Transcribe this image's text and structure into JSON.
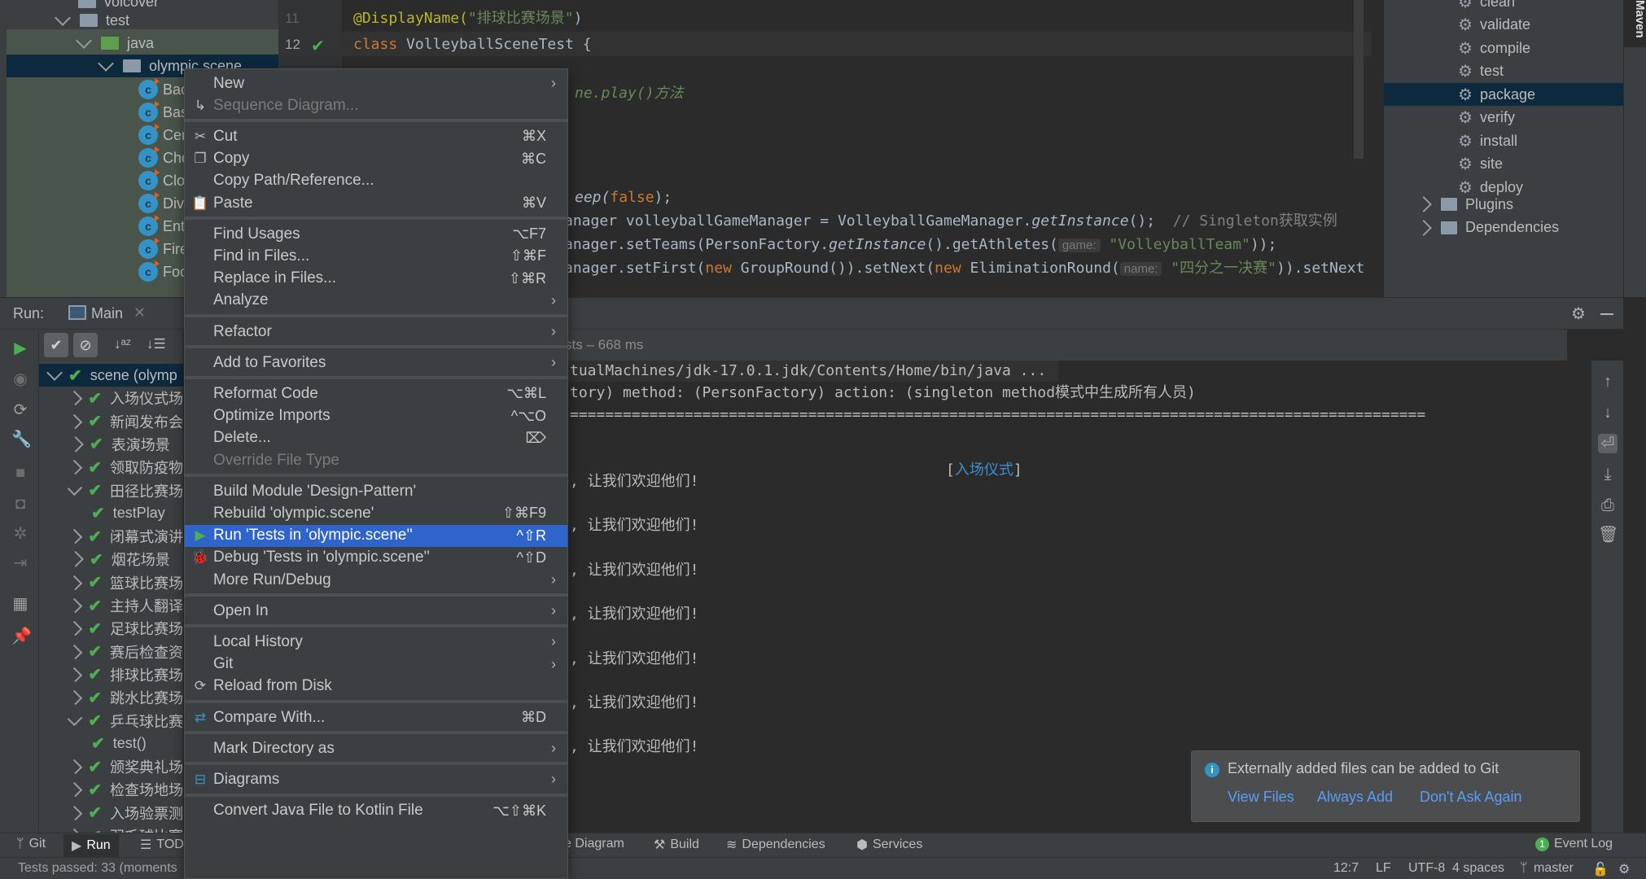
{
  "project_tree": {
    "rows": [
      {
        "label": "volcover",
        "type": "folder-partial"
      },
      {
        "label": "test",
        "type": "folder"
      },
      {
        "label": "java",
        "type": "test-folder"
      },
      {
        "label": "olympic.scene",
        "type": "package",
        "selected": true
      }
    ],
    "classes": [
      "Bac",
      "Bas",
      "Cer",
      "Cho",
      "Clo",
      "Div",
      "Ent",
      "Fire",
      "Foo"
    ]
  },
  "editor": {
    "lines": [
      {
        "num": "11",
        "segments": [
          {
            "t": "@DisplayName(",
            "c": "ann"
          },
          {
            "t": "\"排球比赛场景\"",
            "c": "str"
          },
          {
            "t": ")",
            "c": ""
          }
        ]
      },
      {
        "num": "12",
        "segments": [
          {
            "t": "class ",
            "c": "kw"
          },
          {
            "t": "VolleyballSceneTest {",
            "c": ""
          }
        ]
      },
      {
        "num": "",
        "segments": [
          {
            "t": "ne.play()方法",
            "c": "str it"
          }
        ]
      },
      {
        "num": "",
        "segments": [
          {
            "t": "eep(",
            "c": "it"
          },
          {
            "t": "false",
            "c": "kw"
          },
          {
            "t": ");",
            "c": ""
          }
        ]
      },
      {
        "num": "",
        "segments": [
          {
            "t": "anager volleyballGameManager = VolleyballGameManager.",
            "c": ""
          },
          {
            "t": "getInstance",
            "c": "it"
          },
          {
            "t": "();",
            "c": ""
          },
          {
            "t": "  // Singleton获取实例",
            "c": "cmt"
          }
        ]
      },
      {
        "num": "",
        "segments": [
          {
            "t": "anager.setTeams(PersonFactory.",
            "c": ""
          },
          {
            "t": "getInstance",
            "c": "it"
          },
          {
            "t": "().getAthletes(",
            "c": ""
          },
          {
            "t": "game:",
            "c": "hint"
          },
          {
            "t": " \"VolleyballTeam\"",
            "c": "str"
          },
          {
            "t": "));",
            "c": ""
          }
        ]
      },
      {
        "num": "",
        "segments": [
          {
            "t": "anager.setFirst(",
            "c": ""
          },
          {
            "t": "new ",
            "c": "kw"
          },
          {
            "t": "GroupRound()).setNext(",
            "c": ""
          },
          {
            "t": "new ",
            "c": "kw"
          },
          {
            "t": "EliminationRound(",
            "c": ""
          },
          {
            "t": "name:",
            "c": "hint"
          },
          {
            "t": " \"四分之一决赛\"",
            "c": "str"
          },
          {
            "t": ")).setNext",
            "c": ""
          }
        ]
      }
    ]
  },
  "maven": {
    "tab_label": "Maven",
    "lifecycle": [
      "clean",
      "validate",
      "compile",
      "test",
      "package",
      "verify",
      "install",
      "site",
      "deploy"
    ],
    "selected": "package",
    "groups": [
      "Plugins",
      "Dependencies"
    ]
  },
  "run_panel": {
    "label": "Run:",
    "tab": "Main",
    "status": "sts – 668 ms",
    "tree": [
      {
        "label": "scene (olymp",
        "level": 0,
        "expanded": true,
        "selected": true
      },
      {
        "label": "入场仪式场",
        "level": 1
      },
      {
        "label": "新闻发布会",
        "level": 1
      },
      {
        "label": "表演场景",
        "level": 1
      },
      {
        "label": "领取防疫物",
        "level": 1
      },
      {
        "label": "田径比赛场",
        "level": 1,
        "expanded": true
      },
      {
        "label": "testPlay",
        "level": 2
      },
      {
        "label": "闭幕式演讲",
        "level": 1
      },
      {
        "label": "烟花场景",
        "level": 1
      },
      {
        "label": "篮球比赛场",
        "level": 1
      },
      {
        "label": "主持人翻译",
        "level": 1
      },
      {
        "label": "足球比赛场",
        "level": 1
      },
      {
        "label": "赛后检查资",
        "level": 1
      },
      {
        "label": "排球比赛场",
        "level": 1
      },
      {
        "label": "跳水比赛场",
        "level": 1
      },
      {
        "label": "乒乓球比赛",
        "level": 1,
        "expanded": true
      },
      {
        "label": "test()",
        "level": 2
      },
      {
        "label": "颁奖典礼场",
        "level": 1
      },
      {
        "label": "检查场地场",
        "level": 1
      },
      {
        "label": "入场验票测",
        "level": 1
      },
      {
        "label": "羽毛球比赛",
        "level": 1
      }
    ]
  },
  "console": {
    "lines": [
      "tualMachines/jdk-17.0.1.jdk/Contents/Home/bin/java ...",
      "tory) method: (PersonFactory) action: (singleton method模式中生成所有人员)",
      "=================================================================================================",
      "",
      "",
      ", 让我们欢迎他们!",
      "",
      ", 让我们欢迎他们!",
      "",
      ", 让我们欢迎他们!",
      "",
      ", 让我们欢迎他们!",
      "",
      ", 让我们欢迎他们!",
      "",
      ", 让我们欢迎他们!",
      "",
      ", 让我们欢迎他们!"
    ],
    "section_open": "[",
    "section_title": "入场仪式",
    "section_close": "]"
  },
  "context_menu": {
    "items": [
      {
        "label": "New",
        "submenu": true
      },
      {
        "label": "Sequence Diagram...",
        "disabled": true,
        "icon": "sequence-diagram-icon"
      },
      {
        "sep": true
      },
      {
        "label": "Cut",
        "shortcut": "⌘X",
        "icon": "scissors-icon"
      },
      {
        "label": "Copy",
        "shortcut": "⌘C",
        "icon": "copy-icon"
      },
      {
        "label": "Copy Path/Reference..."
      },
      {
        "label": "Paste",
        "shortcut": "⌘V",
        "icon": "clipboard-icon"
      },
      {
        "sep": true
      },
      {
        "label": "Find Usages",
        "shortcut": "⌥F7"
      },
      {
        "label": "Find in Files...",
        "shortcut": "⇧⌘F"
      },
      {
        "label": "Replace in Files...",
        "shortcut": "⇧⌘R"
      },
      {
        "label": "Analyze",
        "submenu": true
      },
      {
        "sep": true
      },
      {
        "label": "Refactor",
        "submenu": true
      },
      {
        "sep": true
      },
      {
        "label": "Add to Favorites",
        "submenu": true
      },
      {
        "sep": true
      },
      {
        "label": "Reformat Code",
        "shortcut": "⌥⌘L"
      },
      {
        "label": "Optimize Imports",
        "shortcut": "^⌥O"
      },
      {
        "label": "Delete...",
        "shortcut": "⌦"
      },
      {
        "label": "Override File Type",
        "disabled": true
      },
      {
        "sep": true
      },
      {
        "label": "Build Module 'Design-Pattern'"
      },
      {
        "label": "Rebuild 'olympic.scene'",
        "shortcut": "⇧⌘F9"
      },
      {
        "label": "Run 'Tests in 'olympic.scene''",
        "shortcut": "^⇧R",
        "highlighted": true,
        "icon": "run-icon"
      },
      {
        "label": "Debug 'Tests in 'olympic.scene''",
        "shortcut": "^⇧D",
        "icon": "debug-icon"
      },
      {
        "label": "More Run/Debug",
        "submenu": true
      },
      {
        "sep": true
      },
      {
        "label": "Open In",
        "submenu": true
      },
      {
        "sep": true
      },
      {
        "label": "Local History",
        "submenu": true
      },
      {
        "label": "Git",
        "submenu": true
      },
      {
        "label": "Reload from Disk",
        "icon": "reload-icon"
      },
      {
        "sep": true
      },
      {
        "label": "Compare With...",
        "shortcut": "⌘D",
        "icon": "compare-icon"
      },
      {
        "sep": true
      },
      {
        "label": "Mark Directory as",
        "submenu": true
      },
      {
        "sep": true
      },
      {
        "label": "Diagrams",
        "submenu": true,
        "icon": "diagrams-icon"
      },
      {
        "sep": true
      },
      {
        "label": "Convert Java File to Kotlin File",
        "shortcut": "⌥⇧⌘K"
      }
    ]
  },
  "notification": {
    "message": "Externally added files can be added to Git",
    "actions": [
      "View Files",
      "Always Add",
      "Don't Ask Again"
    ]
  },
  "tool_windows": {
    "left": [
      {
        "label": "Git",
        "icon": "git-branch-icon"
      },
      {
        "label": "Run",
        "icon": "run-icon",
        "active": true
      },
      {
        "label": "TOD",
        "icon": "todo-icon"
      }
    ],
    "right": [
      {
        "label": "e Diagram",
        "icon": "diagram-icon"
      },
      {
        "label": "Build",
        "icon": "hammer-icon"
      },
      {
        "label": "Dependencies",
        "icon": "layers-icon"
      },
      {
        "label": "Services",
        "icon": "services-icon"
      }
    ],
    "event_log": "Event Log",
    "event_count": "1"
  },
  "statusbar": {
    "message": "Tests passed: 33 (moments",
    "position": "12:7",
    "line_sep": "LF",
    "encoding": "UTF-8",
    "indent": "4 spaces",
    "branch": "master"
  },
  "colors": {
    "accent": "#2f65ca",
    "success": "#4caf50",
    "link": "#589df6",
    "selection": "#0d293e"
  }
}
